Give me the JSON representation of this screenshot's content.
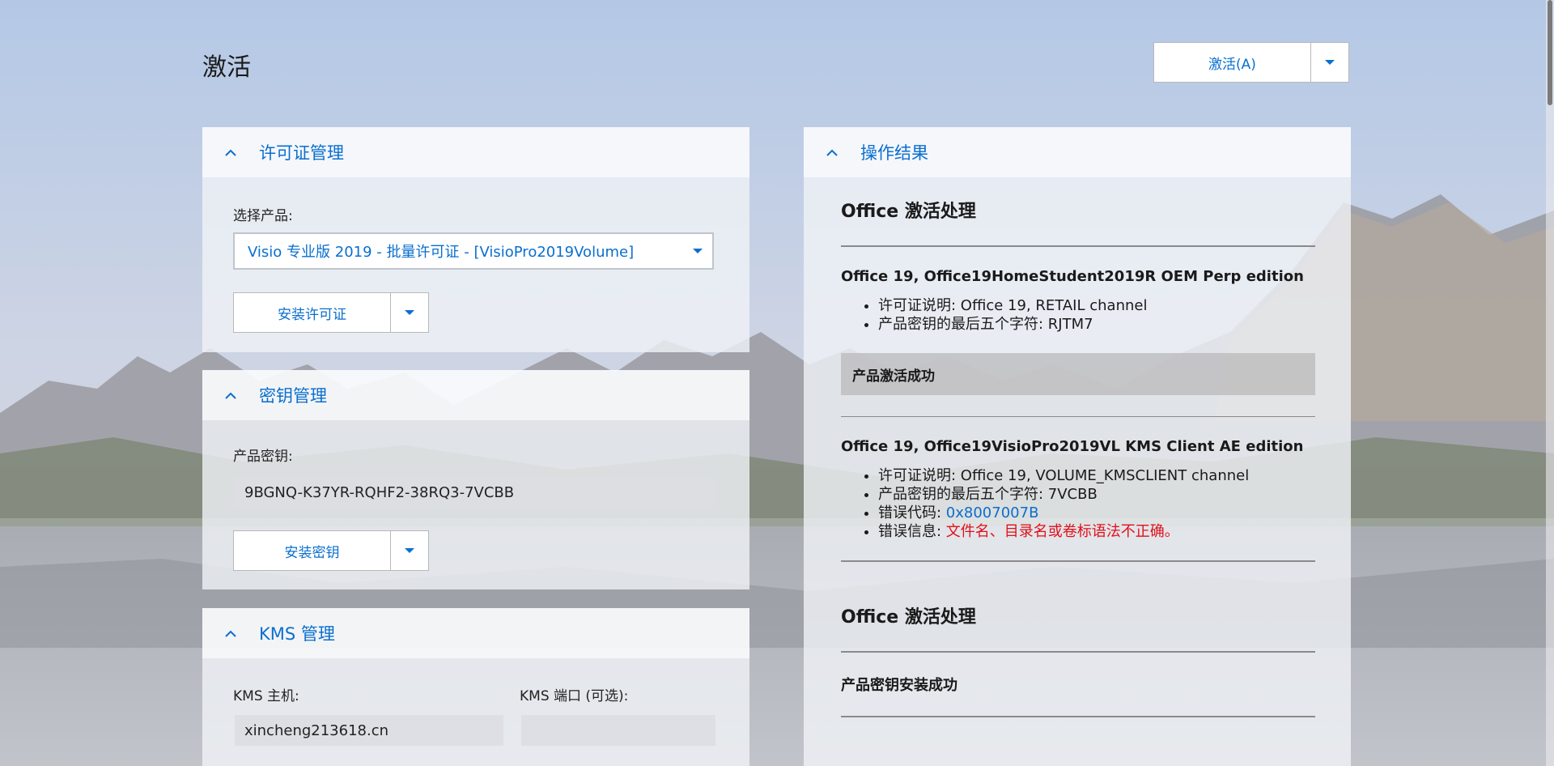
{
  "page": {
    "title": "激活"
  },
  "activate_button": {
    "label": "激活(A)"
  },
  "license_panel": {
    "title": "许可证管理",
    "select_label": "选择产品:",
    "selected_product": "Visio 专业版 2019 - 批量许可证 - [VisioPro2019Volume]",
    "install_button": "安装许可证"
  },
  "key_panel": {
    "title": "密钥管理",
    "key_label": "产品密钥:",
    "key_value": "9BGNQ-K37YR-RQHF2-38RQ3-7VCBB",
    "install_button": "安装密钥"
  },
  "kms_panel": {
    "title": "KMS 管理",
    "host_label": "KMS 主机:",
    "host_value": "xincheng213618.cn",
    "port_label": "KMS 端口 (可选):",
    "port_value": ""
  },
  "results_panel": {
    "title": "操作结果",
    "section1_heading": "Office 激活处理",
    "product1": {
      "name": "Office 19, Office19HomeStudent2019R OEM Perp edition",
      "license_desc": "许可证说明: Office 19, RETAIL channel",
      "last5": "产品密钥的最后五个字符: RJTM7",
      "status": "产品激活成功"
    },
    "product2": {
      "name": "Office 19, Office19VisioPro2019VL KMS Client AE edition",
      "license_desc": "许可证说明: Office 19, VOLUME_KMSCLIENT channel",
      "last5": "产品密钥的最后五个字符: 7VCBB",
      "error_code_label": "错误代码: ",
      "error_code": "0x8007007B",
      "error_msg_label": "错误信息: ",
      "error_msg": "文件名、目录名或卷标语法不正确。"
    },
    "section2_heading": "Office 激活处理",
    "key_install_status": "产品密钥安装成功"
  },
  "colors": {
    "accent": "#0a6fcf",
    "error": "#e0101a"
  }
}
